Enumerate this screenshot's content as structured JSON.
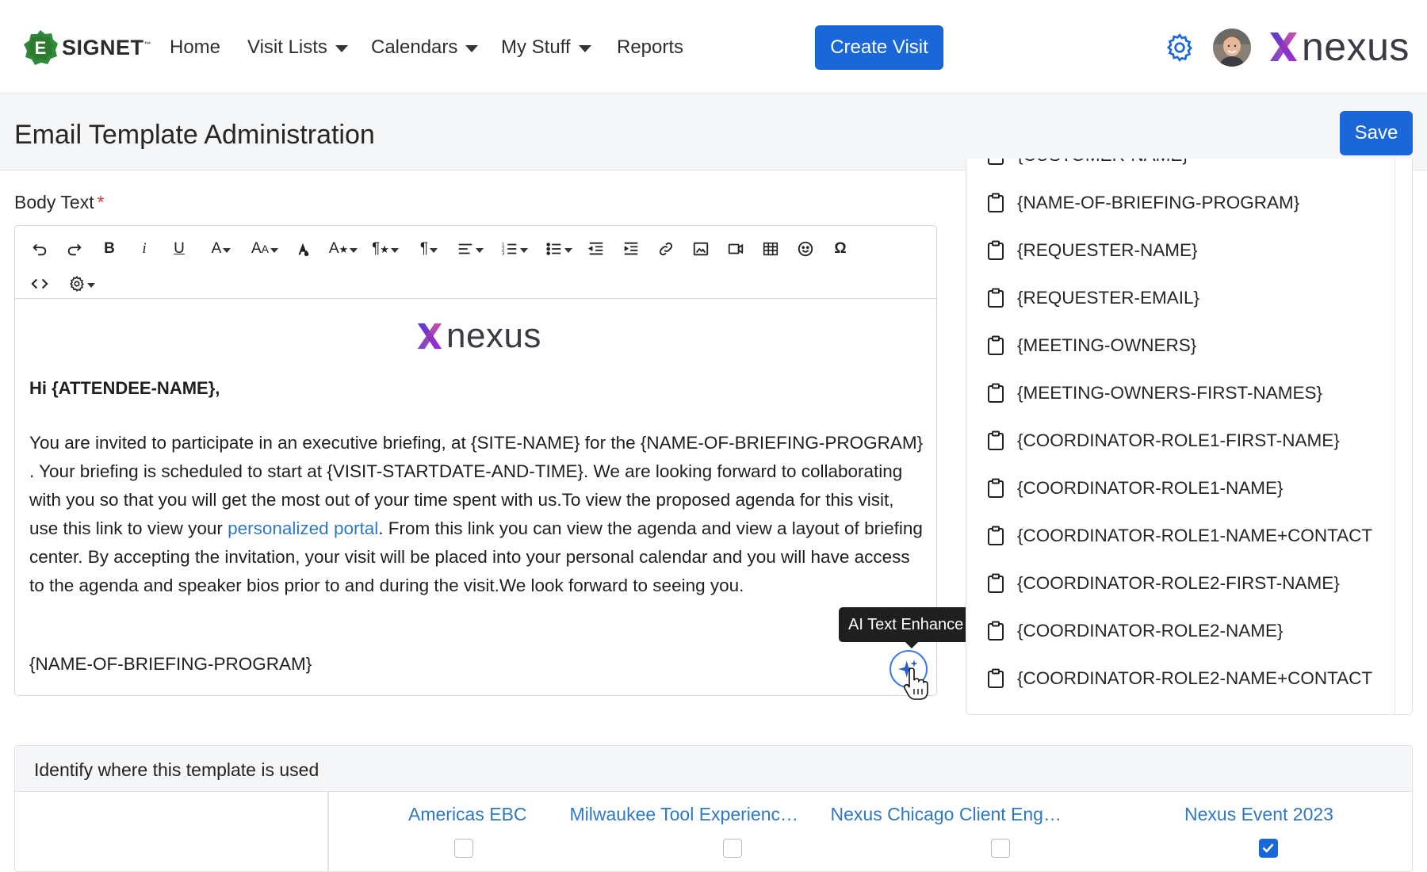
{
  "nav": {
    "brand": "SIGNET",
    "brand_tm": "™",
    "items": [
      {
        "label": "Home"
      },
      {
        "label": "Visit Lists"
      },
      {
        "label": "Calendars"
      },
      {
        "label": "My Stuff"
      },
      {
        "label": "Reports"
      }
    ],
    "create_label": "Create Visit",
    "partner_logo": "nexus"
  },
  "header": {
    "title": "Email Template Administration",
    "save_label": "Save"
  },
  "editor": {
    "label": "Body Text",
    "required_mark": "*",
    "logo": "nexus",
    "greeting": "Hi {ATTENDEE-NAME},",
    "para_before_link": "You are invited to participate in an executive briefing, at {SITE-NAME} for the {NAME-OF-BRIEFING-PROGRAM} . Your briefing is scheduled to start at {VISIT-STARTDATE-AND-TIME}. We are looking forward to collaborating with you so that you will get the most out of your time spent with us.To view the proposed agenda for this visit, use this link to view your ",
    "link_text": "personalized portal",
    "para_after_link": ". From this link you can view the agenda and view a layout of briefing center. By accepting the invitation, your visit will be placed into your personal calendar and you will  have access to the agenda and speaker bios prior to and  during the visit.We look forward to seeing you.",
    "signature": "{NAME-OF-BRIEFING-PROGRAM}",
    "tooltip": "AI Text Enhance"
  },
  "placeholders": [
    "{CUSTOMER-NAME}",
    "{NAME-OF-BRIEFING-PROGRAM}",
    "{REQUESTER-NAME}",
    "{REQUESTER-EMAIL}",
    "{MEETING-OWNERS}",
    "{MEETING-OWNERS-FIRST-NAMES}",
    "{COORDINATOR-ROLE1-FIRST-NAME}",
    "{COORDINATOR-ROLE1-NAME}",
    "{COORDINATOR-ROLE1-NAME+CONTACT",
    "{COORDINATOR-ROLE2-FIRST-NAME}",
    "{COORDINATOR-ROLE2-NAME}",
    "{COORDINATOR-ROLE2-NAME+CONTACT"
  ],
  "usage": {
    "title": "Identify where this template is used",
    "columns": [
      {
        "label": "Americas EBC",
        "checked": false
      },
      {
        "label": "Milwaukee Tool Experienc…",
        "checked": false
      },
      {
        "label": "Nexus Chicago Client Eng…",
        "checked": false
      },
      {
        "label": "Nexus Event 2023",
        "checked": true
      }
    ]
  },
  "colors": {
    "primary": "#1967d8",
    "link": "#2f78c4",
    "brand_green": "#2e8b3a",
    "nexus_purple": "#7b2fc0"
  }
}
